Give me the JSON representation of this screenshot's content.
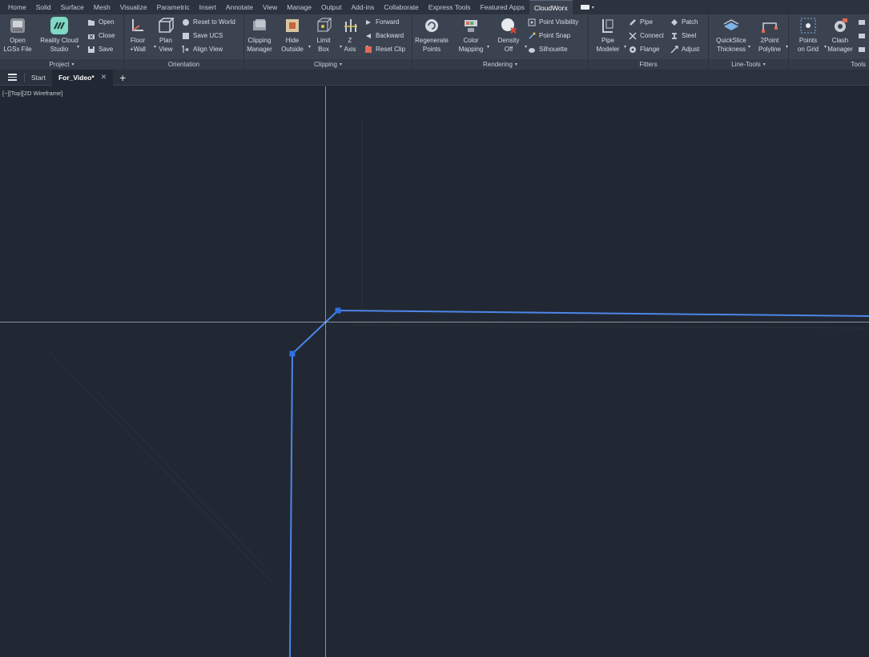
{
  "menu_tabs": [
    "Home",
    "Solid",
    "Surface",
    "Mesh",
    "Visualize",
    "Parametric",
    "Insert",
    "Annotate",
    "View",
    "Manage",
    "Output",
    "Add-ins",
    "Collaborate",
    "Express Tools",
    "Featured Apps",
    "CloudWorx"
  ],
  "active_tab": "CloudWorx",
  "ribbon": {
    "project": {
      "title": "Project",
      "open_lgsx": "Open\nLGSx File",
      "reality_cloud": "Reality Cloud\nStudio",
      "open": "Open",
      "close": "Close",
      "save": "Save"
    },
    "orientation": {
      "title": "Orientation",
      "floor_wall": "Floor\n+Wall",
      "plan_view": "Plan\nView",
      "reset_world": "Reset to World",
      "save_ucs": "Save UCS",
      "align_view": "Align View"
    },
    "clipping": {
      "title": "Clipping",
      "clipping_manager": "Clipping\nManager",
      "hide_outside": "Hide\nOutside",
      "limit_box": "Limit\nBox",
      "z_axis": "Z\nAxis",
      "forward": "Forward",
      "backward": "Backward",
      "reset_clip": "Reset Clip"
    },
    "rendering": {
      "title": "Rendering",
      "regenerate": "Regenerate\nPoints",
      "color_mapping": "Color\nMapping",
      "density_off": "Density\nOff",
      "point_visibility": "Point Visibility",
      "point_snap": "Point Snap",
      "silhouette": "Silhouette"
    },
    "fitters": {
      "title": "Fitters",
      "pipe_modeler": "Pipe\nModeler",
      "pipe": "Pipe",
      "connect": "Connect",
      "flange": "Flange",
      "patch": "Patch",
      "steel": "Steel",
      "adjust": "Adjust"
    },
    "line_tools": {
      "title": "Line-Tools",
      "quickslice": "QuickSlice\nThickness",
      "two_point": "2Point\nPolyline"
    },
    "tools": {
      "title": "Tools",
      "points_on_grid": "Points\non Grid",
      "clash_manager": "Clash\nManager"
    }
  },
  "doc_tabs": {
    "start": "Start",
    "active": "For_Video*"
  },
  "viewport": {
    "label": "[−][Top][2D Wireframe]"
  },
  "colors": {
    "background": "#212833",
    "ribbon": "#3b4350",
    "polyline": "#4d86e8",
    "crosshair": "#b9c0c9"
  }
}
